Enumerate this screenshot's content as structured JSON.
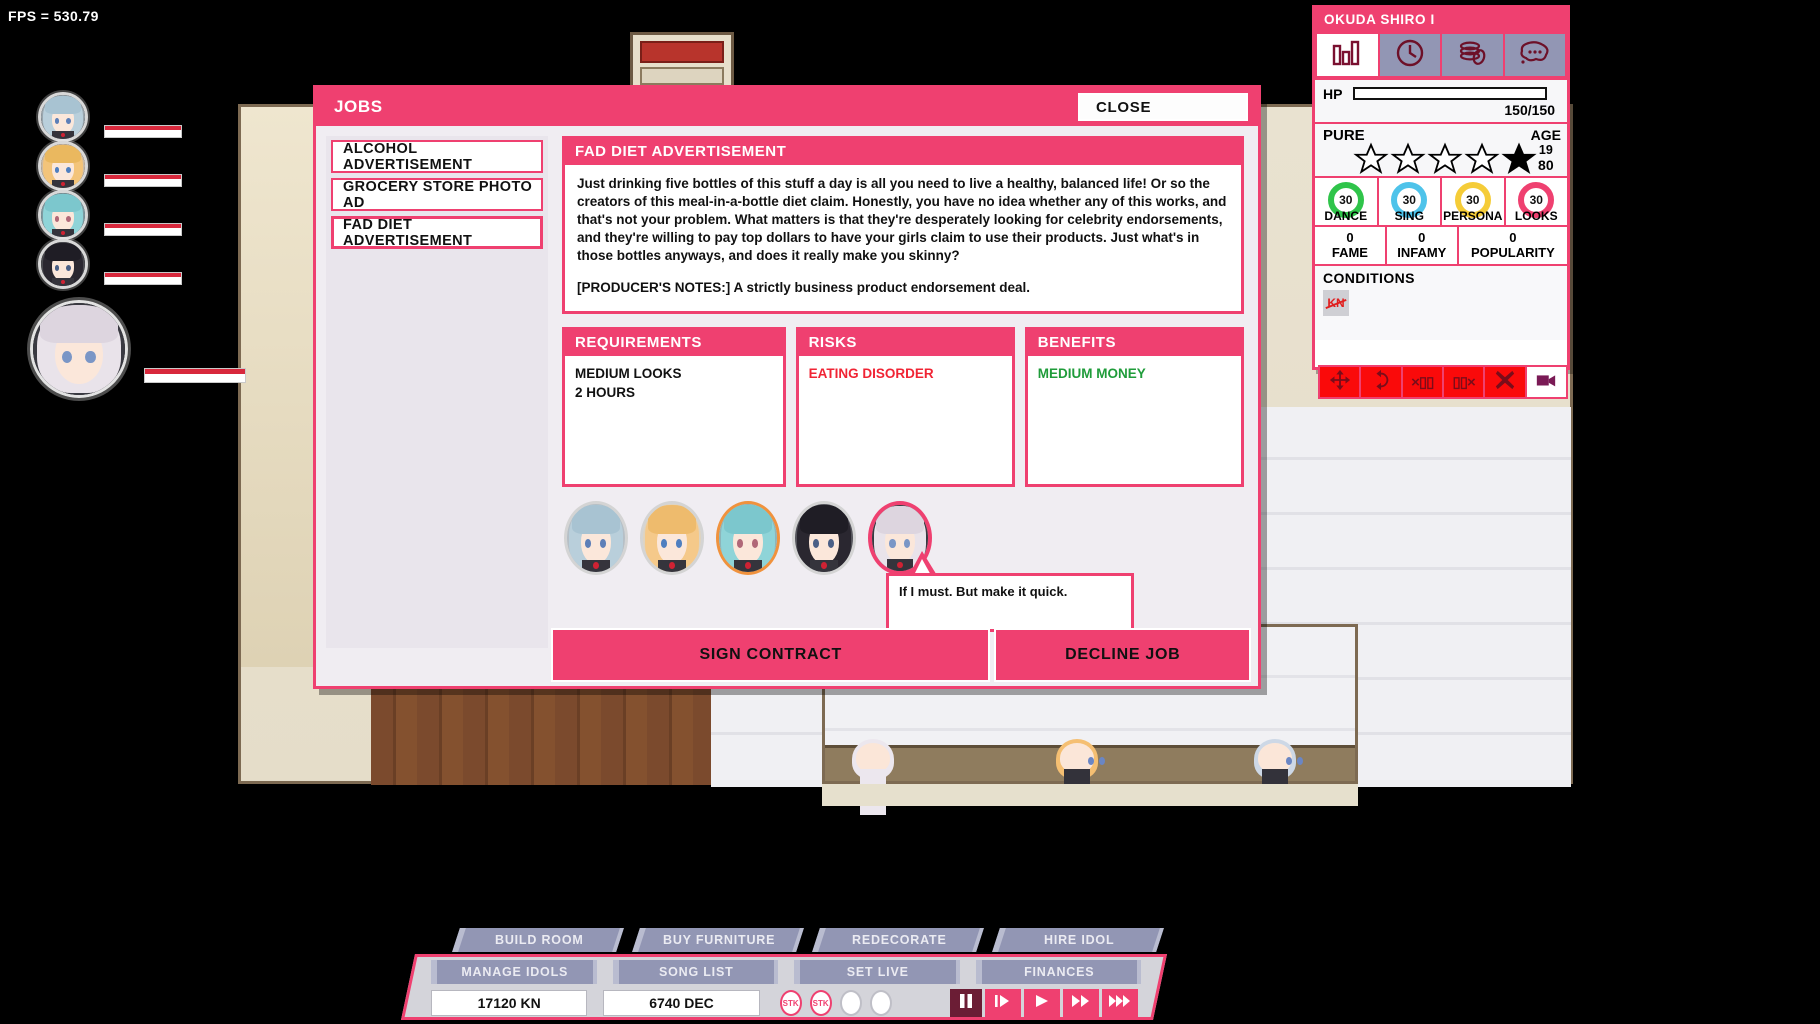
{
  "hud": {
    "fps_label": "FPS = 530.79"
  },
  "roster": {
    "idols": [
      {
        "name": "idol-1",
        "hair": "#b9cfdb",
        "fringe": "#a8c3d2",
        "eye": "#5d7fb8",
        "hp_pct": 100
      },
      {
        "name": "idol-2",
        "hair": "#f3c47a",
        "fringe": "#eab85f",
        "eye": "#4f7fc0",
        "hp_pct": 100
      },
      {
        "name": "idol-3",
        "hair": "#8fd4d8",
        "fringe": "#7cc7cd",
        "eye": "#b06878",
        "hp_pct": 100
      },
      {
        "name": "idol-4",
        "hair": "#2a2730",
        "fringe": "#1f1d25",
        "eye": "#4a5f86",
        "hp_pct": 100
      },
      {
        "name": "idol-5",
        "hair": "#e9e3ea",
        "fringe": "#ddd5df",
        "eye": "#7a96c6",
        "hp_pct": 100
      }
    ]
  },
  "jobs_window": {
    "title": "JOBS",
    "close_label": "CLOSE",
    "job_list": [
      {
        "label": "ALCOHOL ADVERTISEMENT",
        "selected": false
      },
      {
        "label": "GROCERY STORE PHOTO AD",
        "selected": false
      },
      {
        "label": "FAD DIET ADVERTISEMENT",
        "selected": true
      }
    ],
    "detail": {
      "header": "FAD DIET ADVERTISEMENT",
      "description": "Just drinking five bottles of this stuff a day is all you need to live a healthy, balanced life! Or so the creators of this meal-in-a-bottle diet claim. Honestly, you have no idea whether any of this works, and that's not your problem. What matters is that they're desperately looking for celebrity endorsements, and they're willing to pay top dollars to have your girls claim to use their products. Just what's in those bottles anyways, and does it really make you skinny?",
      "producer_notes": "[PRODUCER'S NOTES:] A strictly business product endorsement deal."
    },
    "requirements": {
      "header": "REQUIREMENTS",
      "items": [
        "MEDIUM LOOKS",
        "2 HOURS"
      ]
    },
    "risks": {
      "header": "RISKS",
      "items": [
        "EATING DISORDER"
      ]
    },
    "benefits": {
      "header": "BENEFITS",
      "items": [
        "MEDIUM MONEY"
      ]
    },
    "idol_picker": [
      {
        "name": "picker-idol-1",
        "hair": "#b9cfdb",
        "fringe": "#a8c3d2",
        "eye": "#5d7fb8",
        "state": "normal"
      },
      {
        "name": "picker-idol-2",
        "hair": "#f5c98a",
        "fringe": "#eebb6d",
        "eye": "#4f7fc0",
        "state": "normal"
      },
      {
        "name": "picker-idol-3",
        "hair": "#8fd4d8",
        "fringe": "#7cc7cd",
        "eye": "#b06878",
        "state": "orange"
      },
      {
        "name": "picker-idol-4",
        "hair": "#2a2730",
        "fringe": "#1f1d25",
        "eye": "#4a5f86",
        "state": "normal"
      },
      {
        "name": "picker-idol-5",
        "hair": "#e9e3ea",
        "fringe": "#ddd5df",
        "eye": "#7a96c6",
        "state": "selected"
      }
    ],
    "speech_bubble": "If I must. But make it quick.",
    "sign_label": "SIGN CONTRACT",
    "decline_label": "DECLINE JOB"
  },
  "character_panel": {
    "name": "OKUDA SHIRO I",
    "tabs": [
      {
        "icon": "bar-chart-icon",
        "active": true
      },
      {
        "icon": "clock-icon",
        "active": false
      },
      {
        "icon": "coins-icon",
        "active": false
      },
      {
        "icon": "speech-bubble-icon",
        "active": false
      }
    ],
    "hp": {
      "label": "HP",
      "value": "150/150",
      "pct": 100
    },
    "pure": {
      "label": "PURE",
      "stars_total": 5,
      "stars_filled": 1,
      "filled_index": 4
    },
    "age": {
      "label": "AGE",
      "value": "19",
      "value2": "80"
    },
    "stats": [
      {
        "name": "DANCE",
        "value": "30",
        "color": "#2fc44a"
      },
      {
        "name": "SING",
        "value": "30",
        "color": "#4ec3ea"
      },
      {
        "name": "PERSONA",
        "value": "30",
        "color": "#f5cc38"
      },
      {
        "name": "LOOKS",
        "value": "30",
        "color": "#ef4070"
      }
    ],
    "meta": [
      {
        "name": "FAME",
        "value": "0"
      },
      {
        "name": "INFAMY",
        "value": "0"
      },
      {
        "name": "POPULARITY",
        "value": "0"
      }
    ],
    "conditions": {
      "header": "CONDITIONS",
      "badges": [
        {
          "label": "KN"
        }
      ]
    },
    "toolbar": [
      {
        "icon": "move-icon",
        "style": "red"
      },
      {
        "icon": "rotate-icon",
        "style": "red"
      },
      {
        "icon": "flip-x-icon",
        "glyph": "×▯▯",
        "style": "red"
      },
      {
        "icon": "flip-y-icon",
        "glyph": "▯▯×",
        "style": "red"
      },
      {
        "icon": "delete-icon",
        "style": "red"
      },
      {
        "icon": "camera-icon",
        "style": "white"
      }
    ]
  },
  "bottom_bar": {
    "top_buttons": [
      "BUILD ROOM",
      "BUY FURNITURE",
      "REDECORATE",
      "HIRE IDOL"
    ],
    "mid_buttons": [
      "MANAGE IDOLS",
      "SONG LIST",
      "SET LIVE",
      "FINANCES"
    ],
    "money": "17120 KN",
    "decibels": "6740 DEC",
    "stock_slots": [
      {
        "label": "STK",
        "filled": true
      },
      {
        "label": "STK",
        "filled": true
      },
      {
        "label": "",
        "filled": false
      },
      {
        "label": "",
        "filled": false
      }
    ],
    "speed_controls": [
      {
        "icon": "pause-icon",
        "active": true
      },
      {
        "icon": "play-step-icon",
        "active": false
      },
      {
        "icon": "play-icon",
        "active": false
      },
      {
        "icon": "fast-forward-icon",
        "active": false
      },
      {
        "icon": "very-fast-forward-icon",
        "active": false
      }
    ]
  }
}
